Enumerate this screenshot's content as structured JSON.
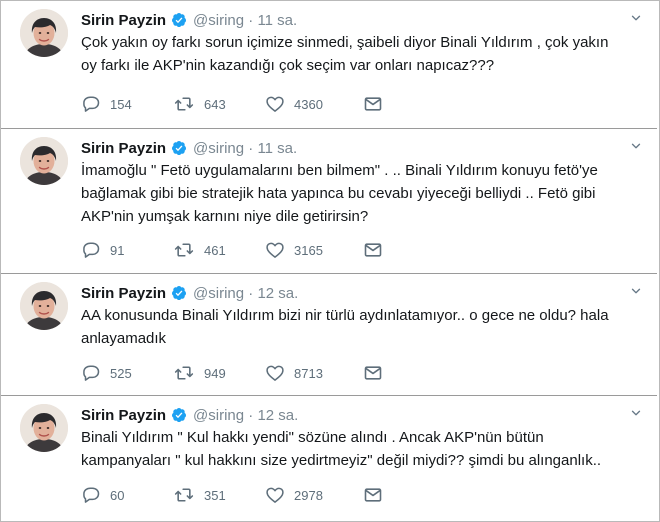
{
  "tweets": [
    {
      "name": "Sirin Payzin",
      "handle": "@siring",
      "time": "· 11 sa.",
      "lines": [
        "Çok yakın oy farkı sorun içimize  sinmedi, şaibeli  diyor Binali Yıldırım  , çok yakın",
        "oy farkı ile AKP'nin kazandığı  çok seçim var  onları napıcaz???"
      ],
      "replies": "154",
      "retweets": "643",
      "likes": "4360"
    },
    {
      "name": "Sirin Payzin",
      "handle": "@siring",
      "time": "· 11 sa.",
      "lines": [
        "İmamoğlu \" Fetö uygulamalarını ben bilmem\" . .. Binali Yıldırım konuyu fetö'ye",
        "bağlamak gibi bie stratejik hata yapınca bu cevabı yiyeceği belliydi .. Fetö gibi",
        "AKP'nin yumşak karnını niye dile getirirsin?"
      ],
      "replies": "91",
      "retweets": "461",
      "likes": "3165"
    },
    {
      "name": "Sirin Payzin",
      "handle": "@siring",
      "time": "· 12 sa.",
      "lines": [
        "AA konusunda Binali Yıldırım  bizi nir türlü aydınlatamıyor.. o gece ne oldu? hala",
        "anlayamadık"
      ],
      "replies": "525",
      "retweets": "949",
      "likes": "8713"
    },
    {
      "name": "Sirin Payzin",
      "handle": "@siring",
      "time": "· 12 sa.",
      "lines": [
        "Binali Yıldırım \" Kul hakkı yendi\"  sözüne alındı . Ancak AKP'nün bütün",
        "kampanyaları \" kul hakkını size yedirtmeyiz\" değil miydi?? şimdi bu alınganlık.."
      ],
      "replies": "60",
      "retweets": "351",
      "likes": "2978"
    }
  ],
  "icons": {
    "verified": "verified-badge-icon",
    "caret": "chevron-down-icon",
    "reply": "reply-icon",
    "retweet": "retweet-icon",
    "like": "heart-icon",
    "dm": "direct-message-icon"
  },
  "colors": {
    "verified": "#1da1f2",
    "icon_gray": "#5e6e7a",
    "text": "#14171a",
    "muted": "#7a8791"
  }
}
